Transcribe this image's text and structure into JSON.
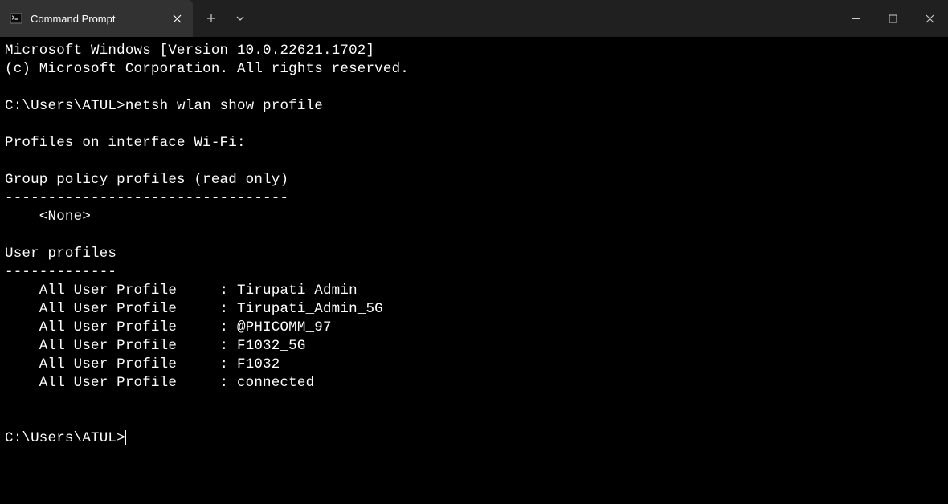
{
  "titlebar": {
    "tab_title": "Command Prompt"
  },
  "terminal": {
    "line_version": "Microsoft Windows [Version 10.0.22621.1702]",
    "line_copyright": "(c) Microsoft Corporation. All rights reserved.",
    "prompt1_path": "C:\\Users\\ATUL>",
    "prompt1_cmd": "netsh wlan show profile",
    "heading_interface": "Profiles on interface Wi-Fi:",
    "heading_group": "Group policy profiles (read only)",
    "rule_group": "---------------------------------",
    "group_none": "    <None>",
    "heading_user": "User profiles",
    "rule_user": "-------------",
    "profile_label": "    All User Profile     : ",
    "profiles": {
      "p0": "Tirupati_Admin",
      "p1": "Tirupati_Admin_5G",
      "p2": "@PHICOMM_97",
      "p3": "F1032_5G",
      "p4": "F1032",
      "p5": "connected"
    },
    "prompt2_path": "C:\\Users\\ATUL>"
  }
}
